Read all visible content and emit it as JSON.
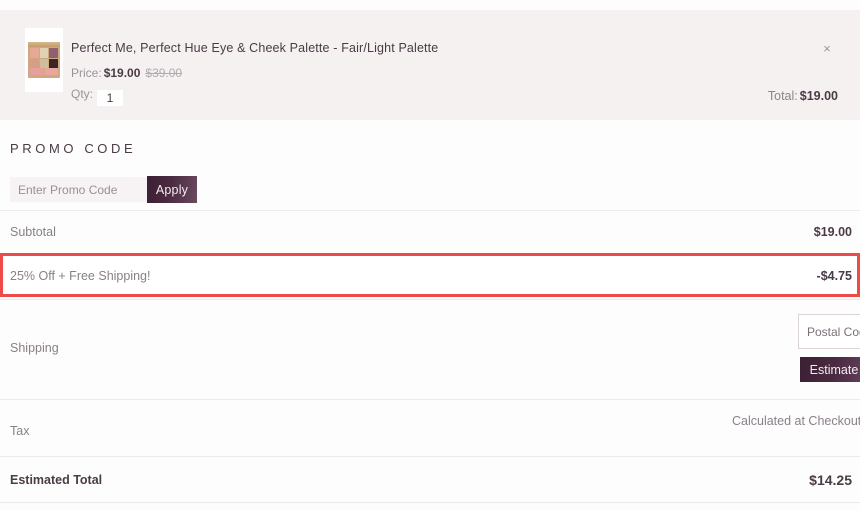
{
  "cart_item": {
    "title": "Perfect Me, Perfect Hue Eye & Cheek Palette - Fair/Light Palette",
    "price_label": "Price:",
    "price_now": "$19.00",
    "price_was": "$39.00",
    "qty_label": "Qty:",
    "qty_value": "1",
    "remove_icon": "×",
    "total_label": "Total:",
    "total_value": "$19.00"
  },
  "promo": {
    "heading": "PROMO CODE",
    "placeholder": "Enter Promo Code",
    "value": "",
    "apply_label": "Apply"
  },
  "summary": {
    "subtotal_label": "Subtotal",
    "subtotal_value": "$19.00",
    "discount_label": "25% Off + Free Shipping!",
    "discount_value": "-$4.75",
    "shipping_label": "Shipping",
    "postal_placeholder": "Postal Code",
    "postal_value": "",
    "estimate_label": "Estimate",
    "tax_label": "Tax",
    "tax_value": "Calculated at Checkout",
    "total_label": "Estimated Total",
    "total_value": "$14.25"
  },
  "colors": {
    "item_background": "#f5f1f1",
    "accent_dark": "#3b1f33",
    "highlight_red": "#ef4a4a",
    "text_dark": "#4a3b46",
    "text_muted": "#8a8089"
  }
}
